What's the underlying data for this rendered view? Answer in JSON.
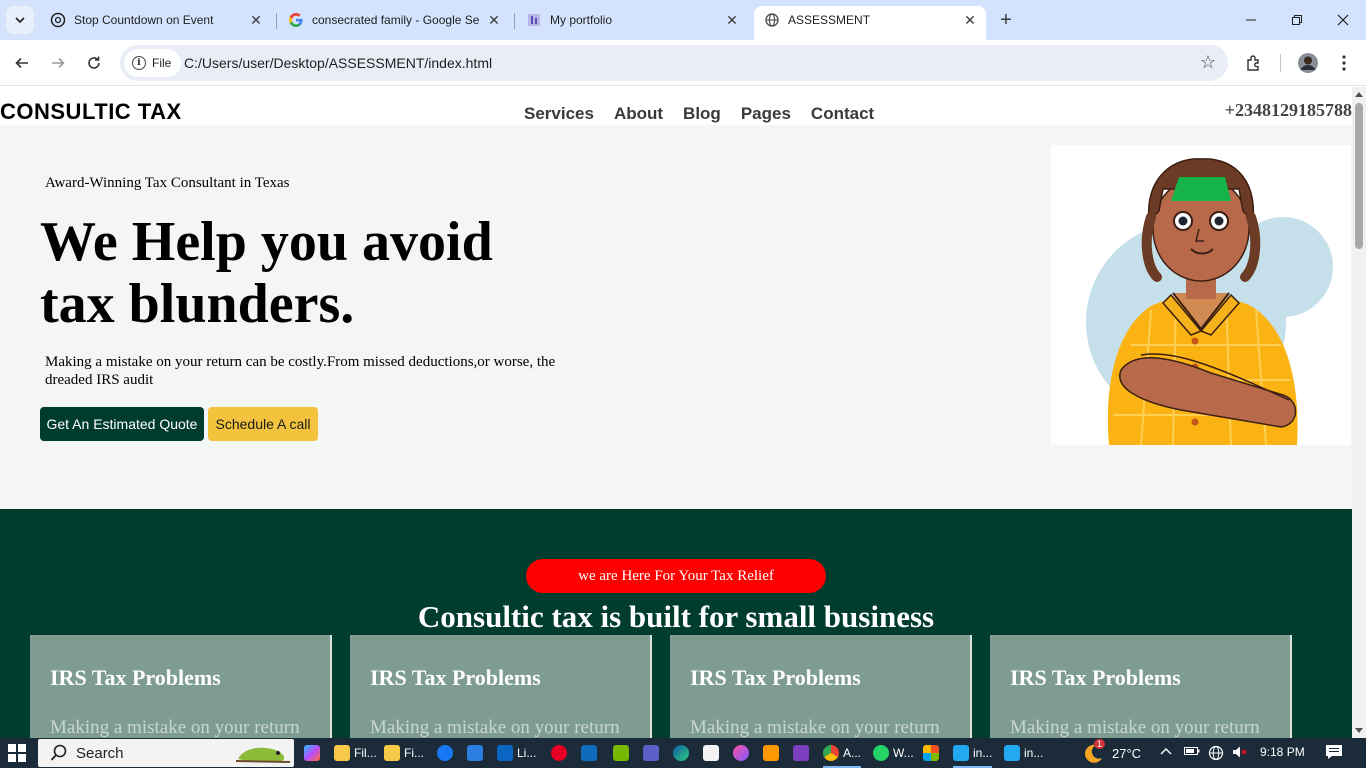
{
  "browser": {
    "tabs": [
      {
        "title": "Stop Countdown on Event",
        "icon": "chatgpt-icon",
        "active": false
      },
      {
        "title": "consecrated family - Google Se",
        "icon": "google-icon",
        "active": false
      },
      {
        "title": "My portfolio",
        "icon": "portfolio-icon",
        "active": false
      },
      {
        "title": "ASSESSMENT",
        "icon": "globe-icon",
        "active": true
      }
    ],
    "chip_label": "File",
    "url": "C:/Users/user/Desktop/ASSESSMENT/index.html"
  },
  "site": {
    "logo": "CONSULTIC TAX",
    "nav": [
      "Services",
      "About",
      "Blog",
      "Pages",
      "Contact"
    ],
    "phone": "+2348129185788"
  },
  "hero": {
    "eyebrow": "Award-Winning Tax Consultant in Texas",
    "headline": "We Help you avoid tax blunders.",
    "lead": "Making a mistake on your return can be costly.From missed deductions,or worse, the dreaded IRS audit",
    "btn_quote": "Get An Estimated Quote",
    "btn_call": "Schedule A call"
  },
  "band": {
    "pill": "we are Here For Your Tax Relief",
    "title": "Consultic tax is built for small business",
    "cards": [
      {
        "title": "IRS Tax Problems",
        "text": "Making a mistake on your return"
      },
      {
        "title": "IRS Tax Problems",
        "text": "Making a mistake on your return"
      },
      {
        "title": "IRS Tax Problems",
        "text": "Making a mistake on your return"
      },
      {
        "title": "IRS Tax Problems",
        "text": "Making a mistake on your return"
      }
    ]
  },
  "taskbar": {
    "search_label": "Search",
    "items": [
      "Fil...",
      "Fi...",
      "Li...",
      "A...",
      "W...",
      "in...",
      "in..."
    ],
    "temperature": "27°C",
    "time": "9:18 PM",
    "weather_badge": "1"
  },
  "colors": {
    "brand_green": "#003d2e",
    "accent_yellow": "#f3c33e",
    "pill_red": "#ff0000",
    "card_bg": "#7f9c91"
  }
}
